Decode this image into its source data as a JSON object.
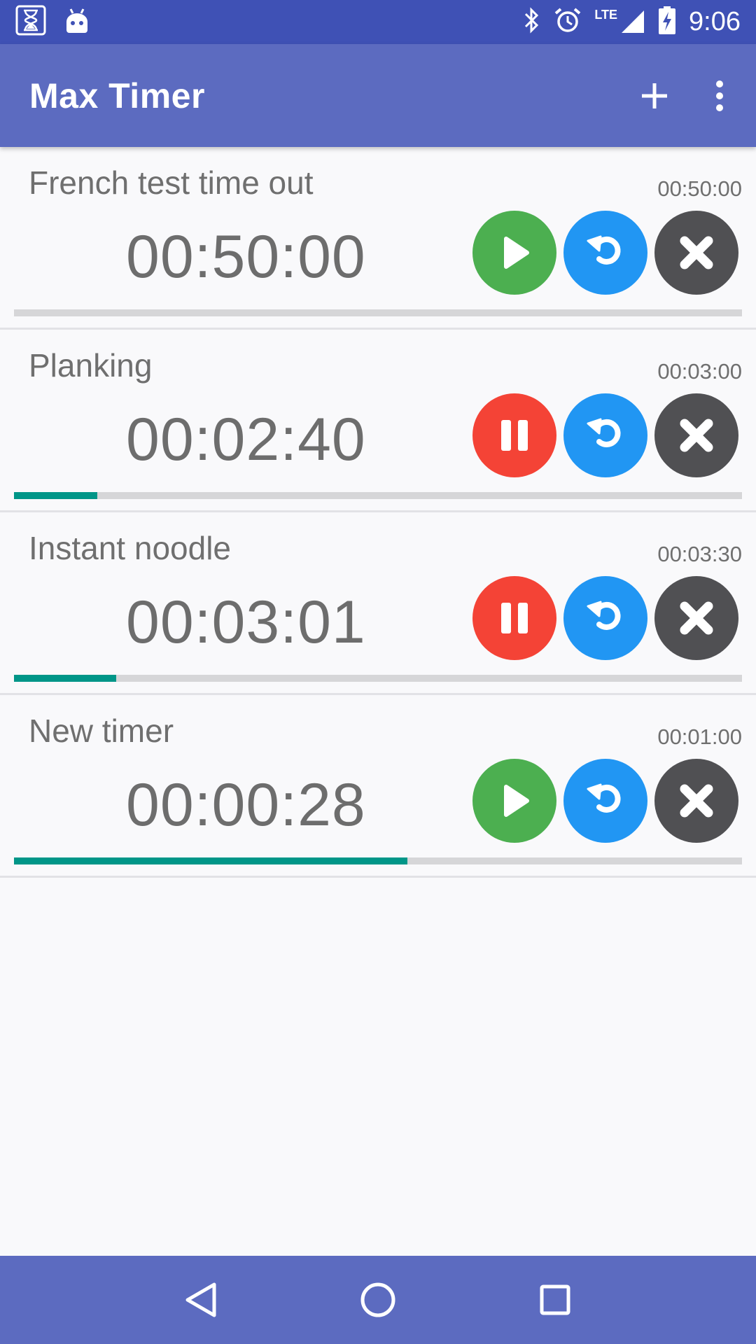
{
  "status_bar": {
    "time": "9:06",
    "network": "LTE",
    "icons": [
      "hourglass-icon",
      "android-icon",
      "bluetooth-icon",
      "alarm-icon",
      "signal-icon",
      "battery-charging-icon"
    ]
  },
  "app_bar": {
    "title": "Max Timer",
    "actions": [
      "add-icon",
      "more-vert-icon"
    ]
  },
  "timers": [
    {
      "name": "French test time out",
      "total": "00:50:00",
      "remaining": "00:50:00",
      "state": "paused",
      "progress": 0.0
    },
    {
      "name": "Planking",
      "total": "00:03:00",
      "remaining": "00:02:40",
      "state": "running",
      "progress": 0.114
    },
    {
      "name": "Instant noodle",
      "total": "00:03:30",
      "remaining": "00:03:01",
      "state": "running",
      "progress": 0.14
    },
    {
      "name": "New timer",
      "total": "00:01:00",
      "remaining": "00:00:28",
      "state": "paused",
      "progress": 0.54
    }
  ],
  "colors": {
    "status_bar": "#3f51b5",
    "app_bar": "#5c6bc0",
    "play": "#4caf50",
    "pause": "#f44336",
    "reset": "#2196f3",
    "delete": "#505053",
    "progress": "#009688"
  },
  "nav_bar": {
    "buttons": [
      "back-icon",
      "home-icon",
      "recents-icon"
    ]
  }
}
